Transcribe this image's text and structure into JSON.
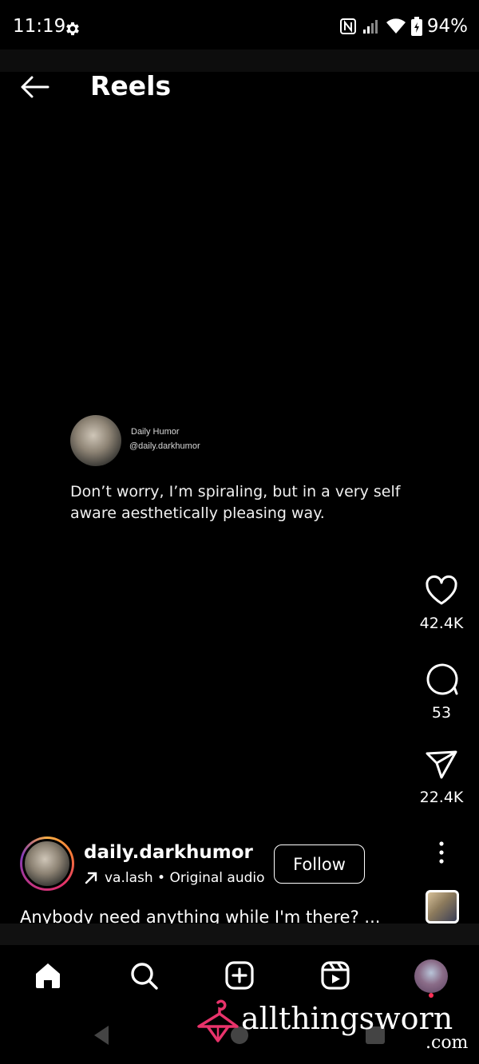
{
  "status_bar": {
    "time": "11:19",
    "battery": "94%",
    "icons": [
      "gear-icon",
      "nfc-icon",
      "signal-icon",
      "wifi-icon",
      "battery-icon"
    ]
  },
  "header": {
    "title": "Reels",
    "back_icon": "arrow-left-icon"
  },
  "reel_card": {
    "author_name": "Daily Humor",
    "author_handle": "@daily.darkhumor",
    "text": "Don’t worry, I’m spiraling, but in a very self aware aesthetically pleasing way."
  },
  "actions": {
    "likes": "42.4K",
    "comments": "53",
    "shares": "22.4K"
  },
  "author": {
    "username": "daily.darkhumor",
    "audio": "va.lash • Original audio",
    "follow_label": "Follow"
  },
  "caption": "Anybody need anything while I'm there? ...",
  "bottom_nav": {
    "items": [
      "home-icon",
      "search-icon",
      "create-icon",
      "reels-icon",
      "profile-avatar"
    ]
  },
  "watermark": {
    "text": "allthingsworn",
    "suffix": ".com"
  },
  "colors": {
    "background": "#000000",
    "text": "#ffffff",
    "story_ring": [
      "#fcaf45",
      "#e1306c",
      "#833ab4"
    ],
    "watermark_logo": "#e8336b"
  }
}
